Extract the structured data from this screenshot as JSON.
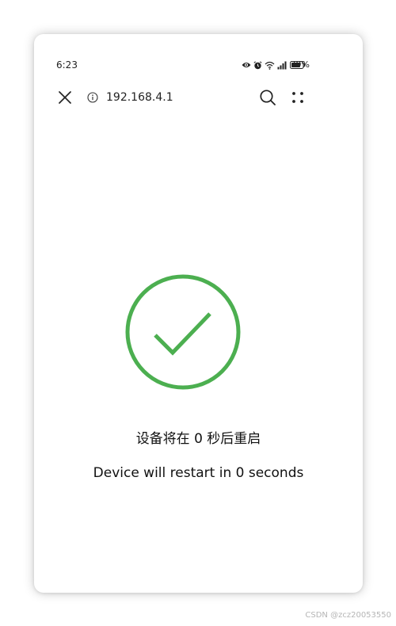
{
  "status_bar": {
    "time": "6:23",
    "battery_percent": "79%",
    "icons": [
      "eye-icon",
      "alarm-icon",
      "wifi-icon",
      "signal-icon",
      "battery-icon"
    ]
  },
  "browser": {
    "url": "192.168.4.1"
  },
  "content": {
    "success_color": "#4caf50",
    "message_cn": "设备将在 0 秒后重启",
    "message_en": "Device will restart in 0 seconds"
  },
  "watermark": "CSDN @zcz20053550"
}
